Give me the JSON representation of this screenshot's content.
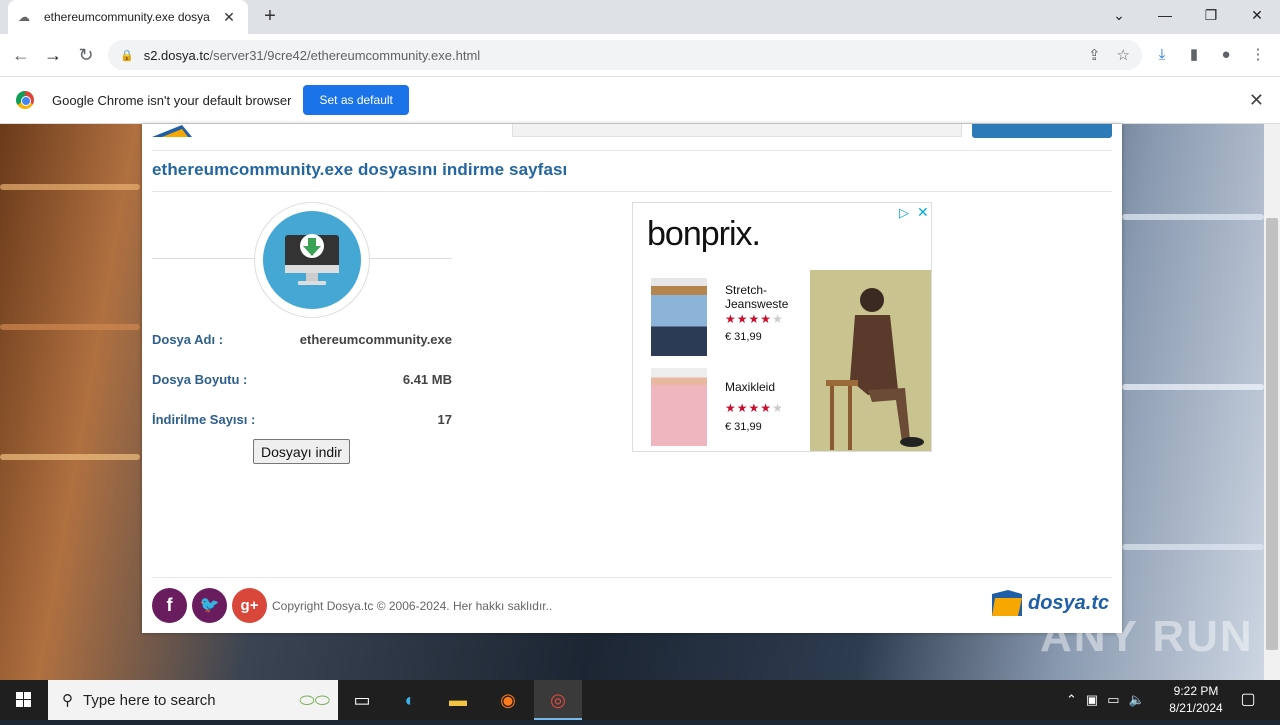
{
  "browser": {
    "tab_title": "ethereumcommunity.exe dosya",
    "tab_close": "✕",
    "new_tab": "+",
    "url_host": "s2.dosya.tc",
    "url_path": "/server31/9cre42/ethereumcommunity.exe.html",
    "window_controls": [
      "⌄",
      "—",
      "❐",
      "✕"
    ],
    "infobar_text": "Google Chrome isn't your default browser",
    "infobar_button": "Set as default",
    "infobar_close": "✕"
  },
  "page": {
    "heading": "ethereumcommunity.exe dosyasını indirme sayfası",
    "file_name_label": "Dosya Adı :",
    "file_name_value": "ethereumcommunity.exe",
    "file_size_label": "Dosya Boyutu :",
    "file_size_value": "6.41 MB",
    "downloads_label": "İndirilme Sayısı :",
    "downloads_value": "17",
    "download_button": "Dosyayı indir",
    "copyright": "Copyright Dosya.tc © 2006-2024. Her hakkı saklıdır..",
    "footer_logo": "dosya.tc"
  },
  "ad": {
    "brand": "bonprix.",
    "products": [
      {
        "name": "Stretch-Jeansweste",
        "rating": 4,
        "max_rating": 5,
        "price": "€ 31,99"
      },
      {
        "name": "Maxikleid",
        "rating": 4,
        "max_rating": 5,
        "price": "€ 31,99"
      }
    ],
    "star_color": "#c8102e",
    "star_empty_color": "#cccccc"
  },
  "taskbar": {
    "search_placeholder": "Type here to search",
    "time": "9:22 PM",
    "date": "8/21/2024"
  },
  "watermark": "ANY RUN"
}
